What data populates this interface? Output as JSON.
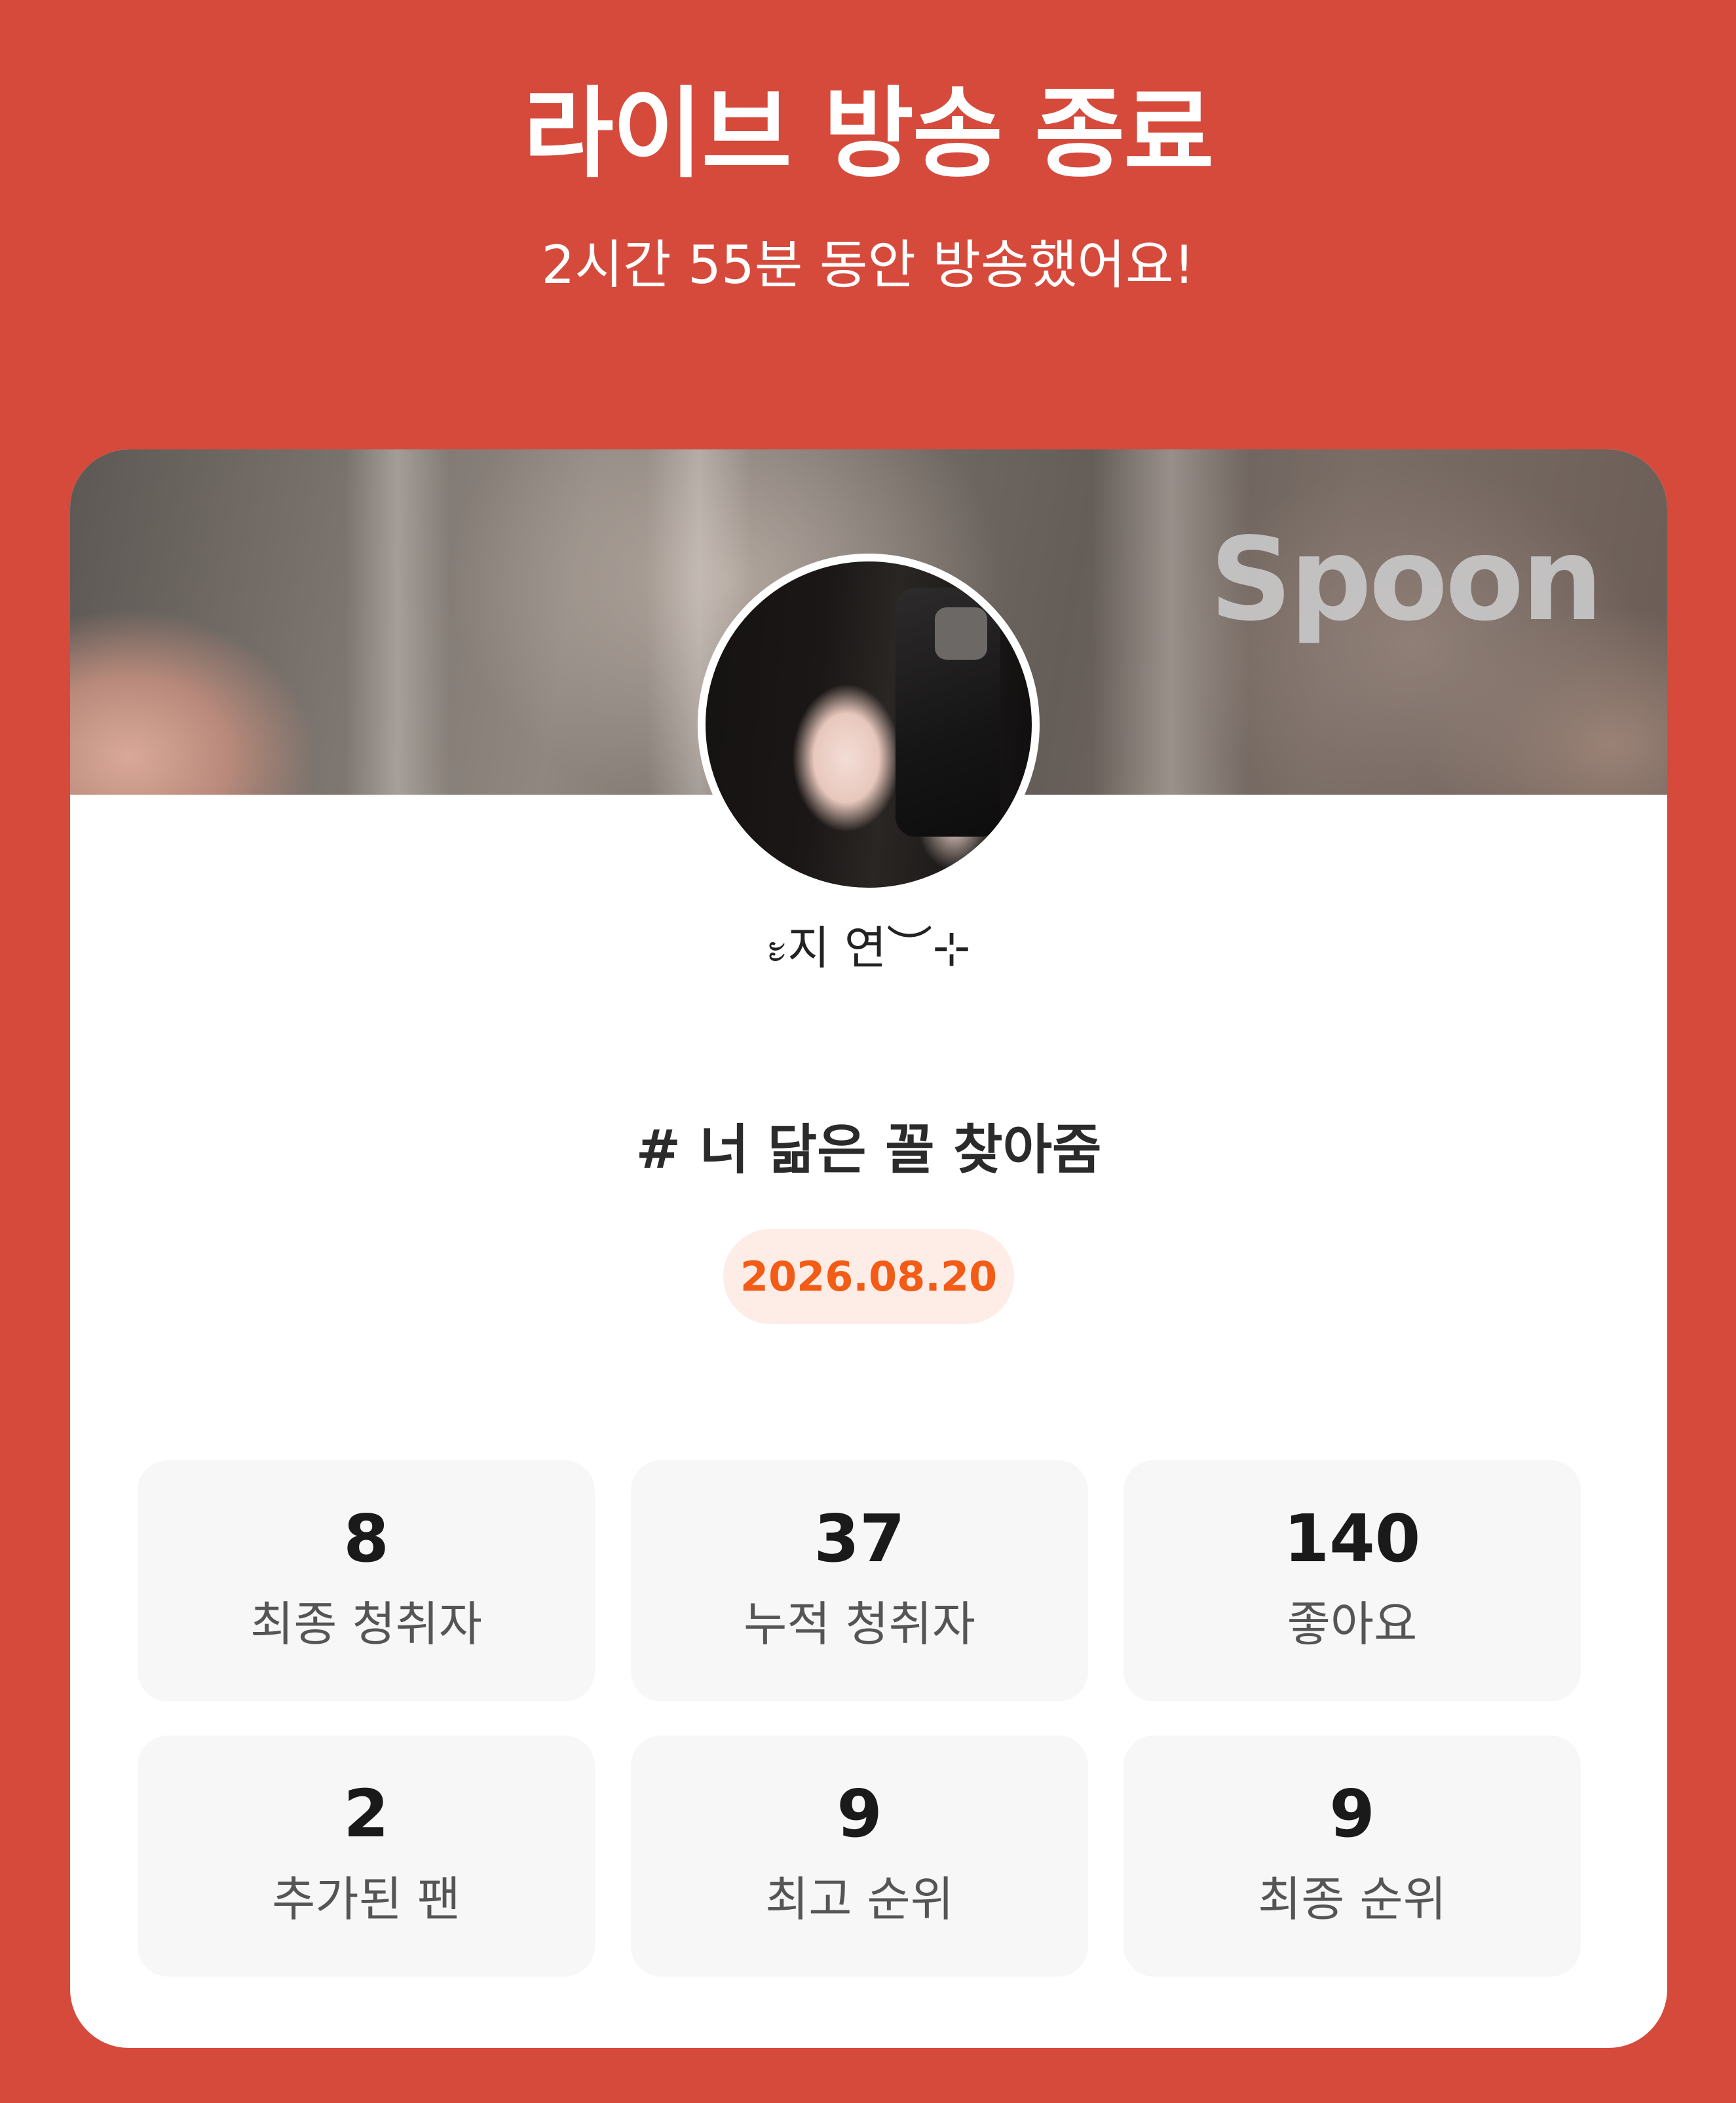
{
  "header": {
    "title": "라이브 방송 종료",
    "subtitle": "2시간 55분 동안 방송했어요!"
  },
  "banner": {
    "logo": "Spoon"
  },
  "profile": {
    "nickname": "᭝지 연︶⊹"
  },
  "broadcast": {
    "title": "# 너 닮은 꼴 찾아줌",
    "date": "2026.08.20"
  },
  "stats": [
    {
      "value": "8",
      "label": "최종 청취자"
    },
    {
      "value": "37",
      "label": "누적 청취자"
    },
    {
      "value": "140",
      "label": "좋아요"
    },
    {
      "value": "2",
      "label": "추가된 팬"
    },
    {
      "value": "9",
      "label": "최고 순위"
    },
    {
      "value": "9",
      "label": "최종 순위"
    }
  ],
  "colors": {
    "background": "#D64A3C",
    "date_text": "#F25C16",
    "date_badge": "#FDEDE6",
    "stat_tile": "#F7F7F7"
  }
}
